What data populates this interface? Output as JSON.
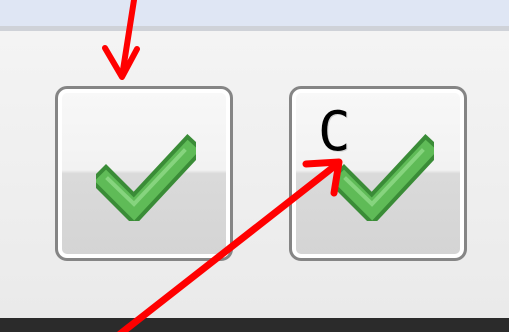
{
  "toolbar": {
    "buttons": [
      {
        "icon": "checkmark-icon",
        "letter": ""
      },
      {
        "icon": "checkmark-icon",
        "letter": "C"
      }
    ]
  },
  "colors": {
    "check_fill": "#56b04f",
    "check_dark": "#3a8c37",
    "arrow": "#ff0000",
    "button_border": "#858585"
  }
}
